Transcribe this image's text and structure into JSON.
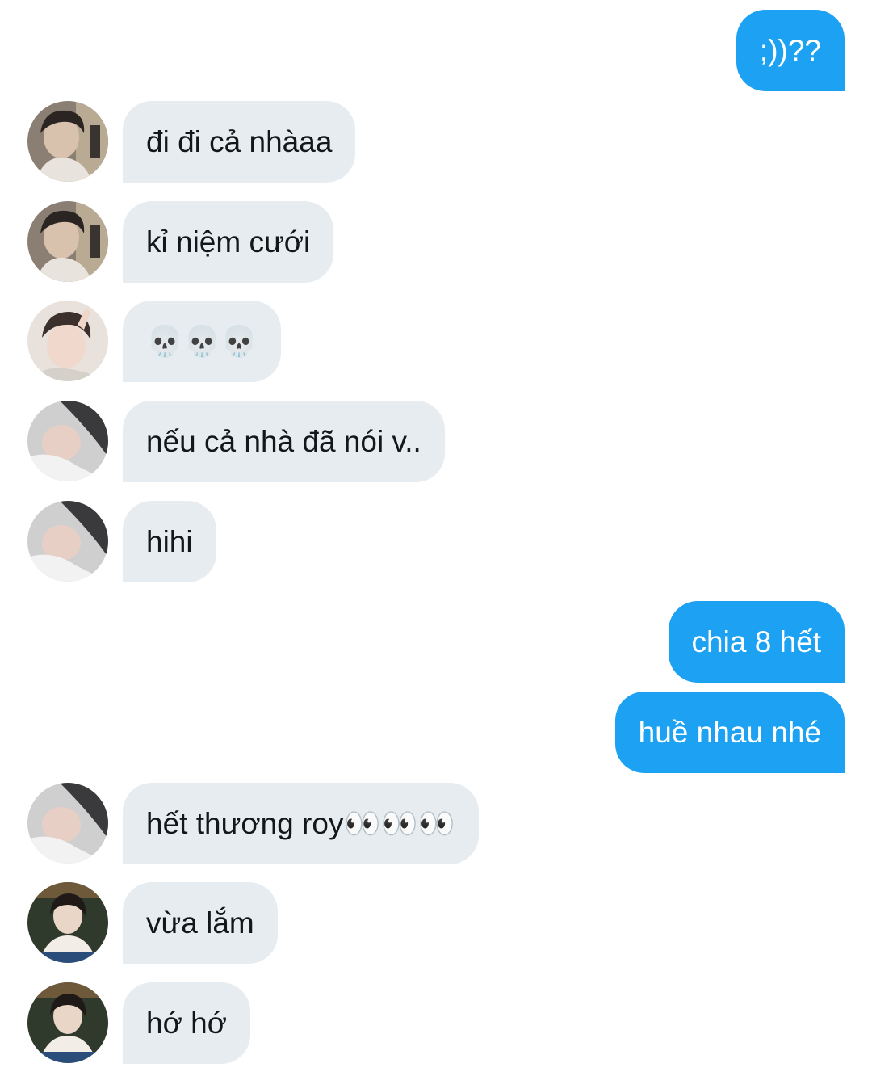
{
  "conversation": {
    "messages": [
      {
        "side": "out",
        "text": ";))??"
      },
      {
        "side": "in",
        "avatar": "avatar-a",
        "text": "đi đi cả nhàaa"
      },
      {
        "side": "in",
        "avatar": "avatar-a",
        "text": "kỉ niệm cưới"
      },
      {
        "side": "in",
        "avatar": "avatar-b",
        "text": "💀💀💀"
      },
      {
        "side": "in",
        "avatar": "avatar-c",
        "text": "nếu cả nhà đã nói v.."
      },
      {
        "side": "in",
        "avatar": "avatar-c",
        "text": "hihi"
      },
      {
        "side": "out",
        "text": "chia 8 hết"
      },
      {
        "side": "out",
        "text": "huề nhau nhé"
      },
      {
        "side": "in",
        "avatar": "avatar-c",
        "text": "hết thương roy👀👀👀"
      },
      {
        "side": "in",
        "avatar": "avatar-d",
        "text": "vừa lắm"
      },
      {
        "side": "in",
        "avatar": "avatar-d",
        "text": "hớ hớ"
      }
    ]
  },
  "colors": {
    "outgoing_bubble": "#1da1f2",
    "incoming_bubble": "#e6ecf0",
    "incoming_text": "#14171a"
  }
}
